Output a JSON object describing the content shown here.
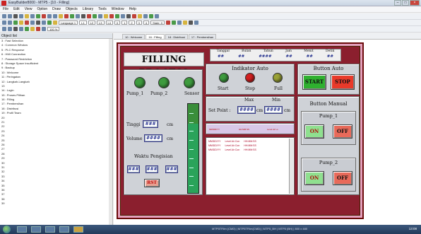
{
  "window": {
    "title": "EasyBuilder8000 - MTP5 - [10 - Filling]"
  },
  "menu": [
    "File",
    "Edit",
    "View",
    "Option",
    "Draw",
    "Objects",
    "Library",
    "Tools",
    "Window",
    "Help"
  ],
  "toolbar": {
    "screen_combo": "Language 1",
    "zoom": "100 %",
    "state_combo": "State: 0",
    "nums": [
      "L1",
      "L2",
      "L3",
      "L4",
      "0",
      "1",
      "2",
      "3",
      "4"
    ]
  },
  "left_panel": {
    "title": "Object list",
    "items": [
      "3 : Fast Selection",
      "4 : Common Window",
      "5 : PLC Response",
      "6 : HMI Connection",
      "7 : Password Restriction",
      "8 : Storage Space Insufficient",
      "9 : Backup",
      "10 : Welcome",
      "11 : Peringatan",
      "12 : Langkah-Langkah",
      "13",
      "14 : Login",
      "15 : Proses Pilihan",
      "16 : Filling",
      "17 : Pembersihan",
      "18 : Distribusi",
      "19 : Profil Team",
      "20",
      "21",
      "22",
      "23",
      "24",
      "25",
      "26",
      "27",
      "28",
      "29",
      "30",
      "31",
      "32",
      "33",
      "34",
      "35",
      "36",
      "37",
      "38",
      "39"
    ]
  },
  "tabs": [
    "10 : Welcome",
    "16 : Filling",
    "18 : Distribusi",
    "17 : Pembersihan"
  ],
  "hmi": {
    "title": "FILLING PROCESS",
    "lamps": [
      {
        "label": "Pump_1",
        "color": "#3e9b3e"
      },
      {
        "label": "Pump_2",
        "color": "#3e9b3e"
      },
      {
        "label": "Sensor",
        "color": "#3e9b3e"
      }
    ],
    "tinggi_label": "Tinggi",
    "tinggi_value": "###",
    "tinggi_unit": "cm",
    "volume_label": "Volume",
    "volume_value": "####",
    "volume_unit": "cm",
    "waktu_label": "Waktu Pengisian",
    "time_fields": [
      "###",
      "###",
      "###"
    ],
    "rst_label": "RST",
    "datetime_headers": [
      "Tanggal",
      "Bulan",
      "Tahun",
      "Jam",
      "Menit",
      "Detik"
    ],
    "datetime_values": [
      "##",
      "##",
      "####",
      "##",
      "##",
      "##"
    ],
    "indicator_title": "Indikator Auto",
    "indicators": [
      {
        "label": "Start",
        "color": "#3e9b3e"
      },
      {
        "label": "Stop",
        "color": "#d42020"
      },
      {
        "label": "Full",
        "color": "#9aa236"
      }
    ],
    "max_label": "Max",
    "min_label": "Min",
    "setpoint_label": "Set Point :",
    "setpoint_max": "####",
    "setpoint_min": "####",
    "unit_cm": "cm",
    "alarm_header": [
      "MM/DD/YY",
      "HH:MM:SS",
      "Level Air Lo"
    ],
    "alarm_rows": [
      [
        "MM/DD/YY",
        "Level Air Con",
        "HH:MM:SS"
      ],
      [
        "MM/DD/YY",
        "Level Air Con",
        "HH:MM:SS"
      ],
      [
        "MM/DD/YY",
        "Level Air Con",
        "HH:MM:SS"
      ]
    ],
    "button_auto_title": "Button Auto",
    "start_label": "START",
    "stop_label": "STOP",
    "button_manual_title": "Button Manual",
    "pump1_title": "Pump_1",
    "pump2_title": "Pump_2",
    "on_label": "ON",
    "off_label": "OFF",
    "tank_level": 0.78
  },
  "statusbar": {
    "text": "MTP5TFilm (CMD) | MTP5TFilm(CMD) | MTP5_BH | MTP5 (BH) | 800 x 480",
    "clock": "13:08"
  },
  "colors": {
    "on_green": "#8fe08f",
    "off_red": "#e86a5a",
    "start_green": "#2fb02f",
    "stop_red": "#e83a2a"
  }
}
